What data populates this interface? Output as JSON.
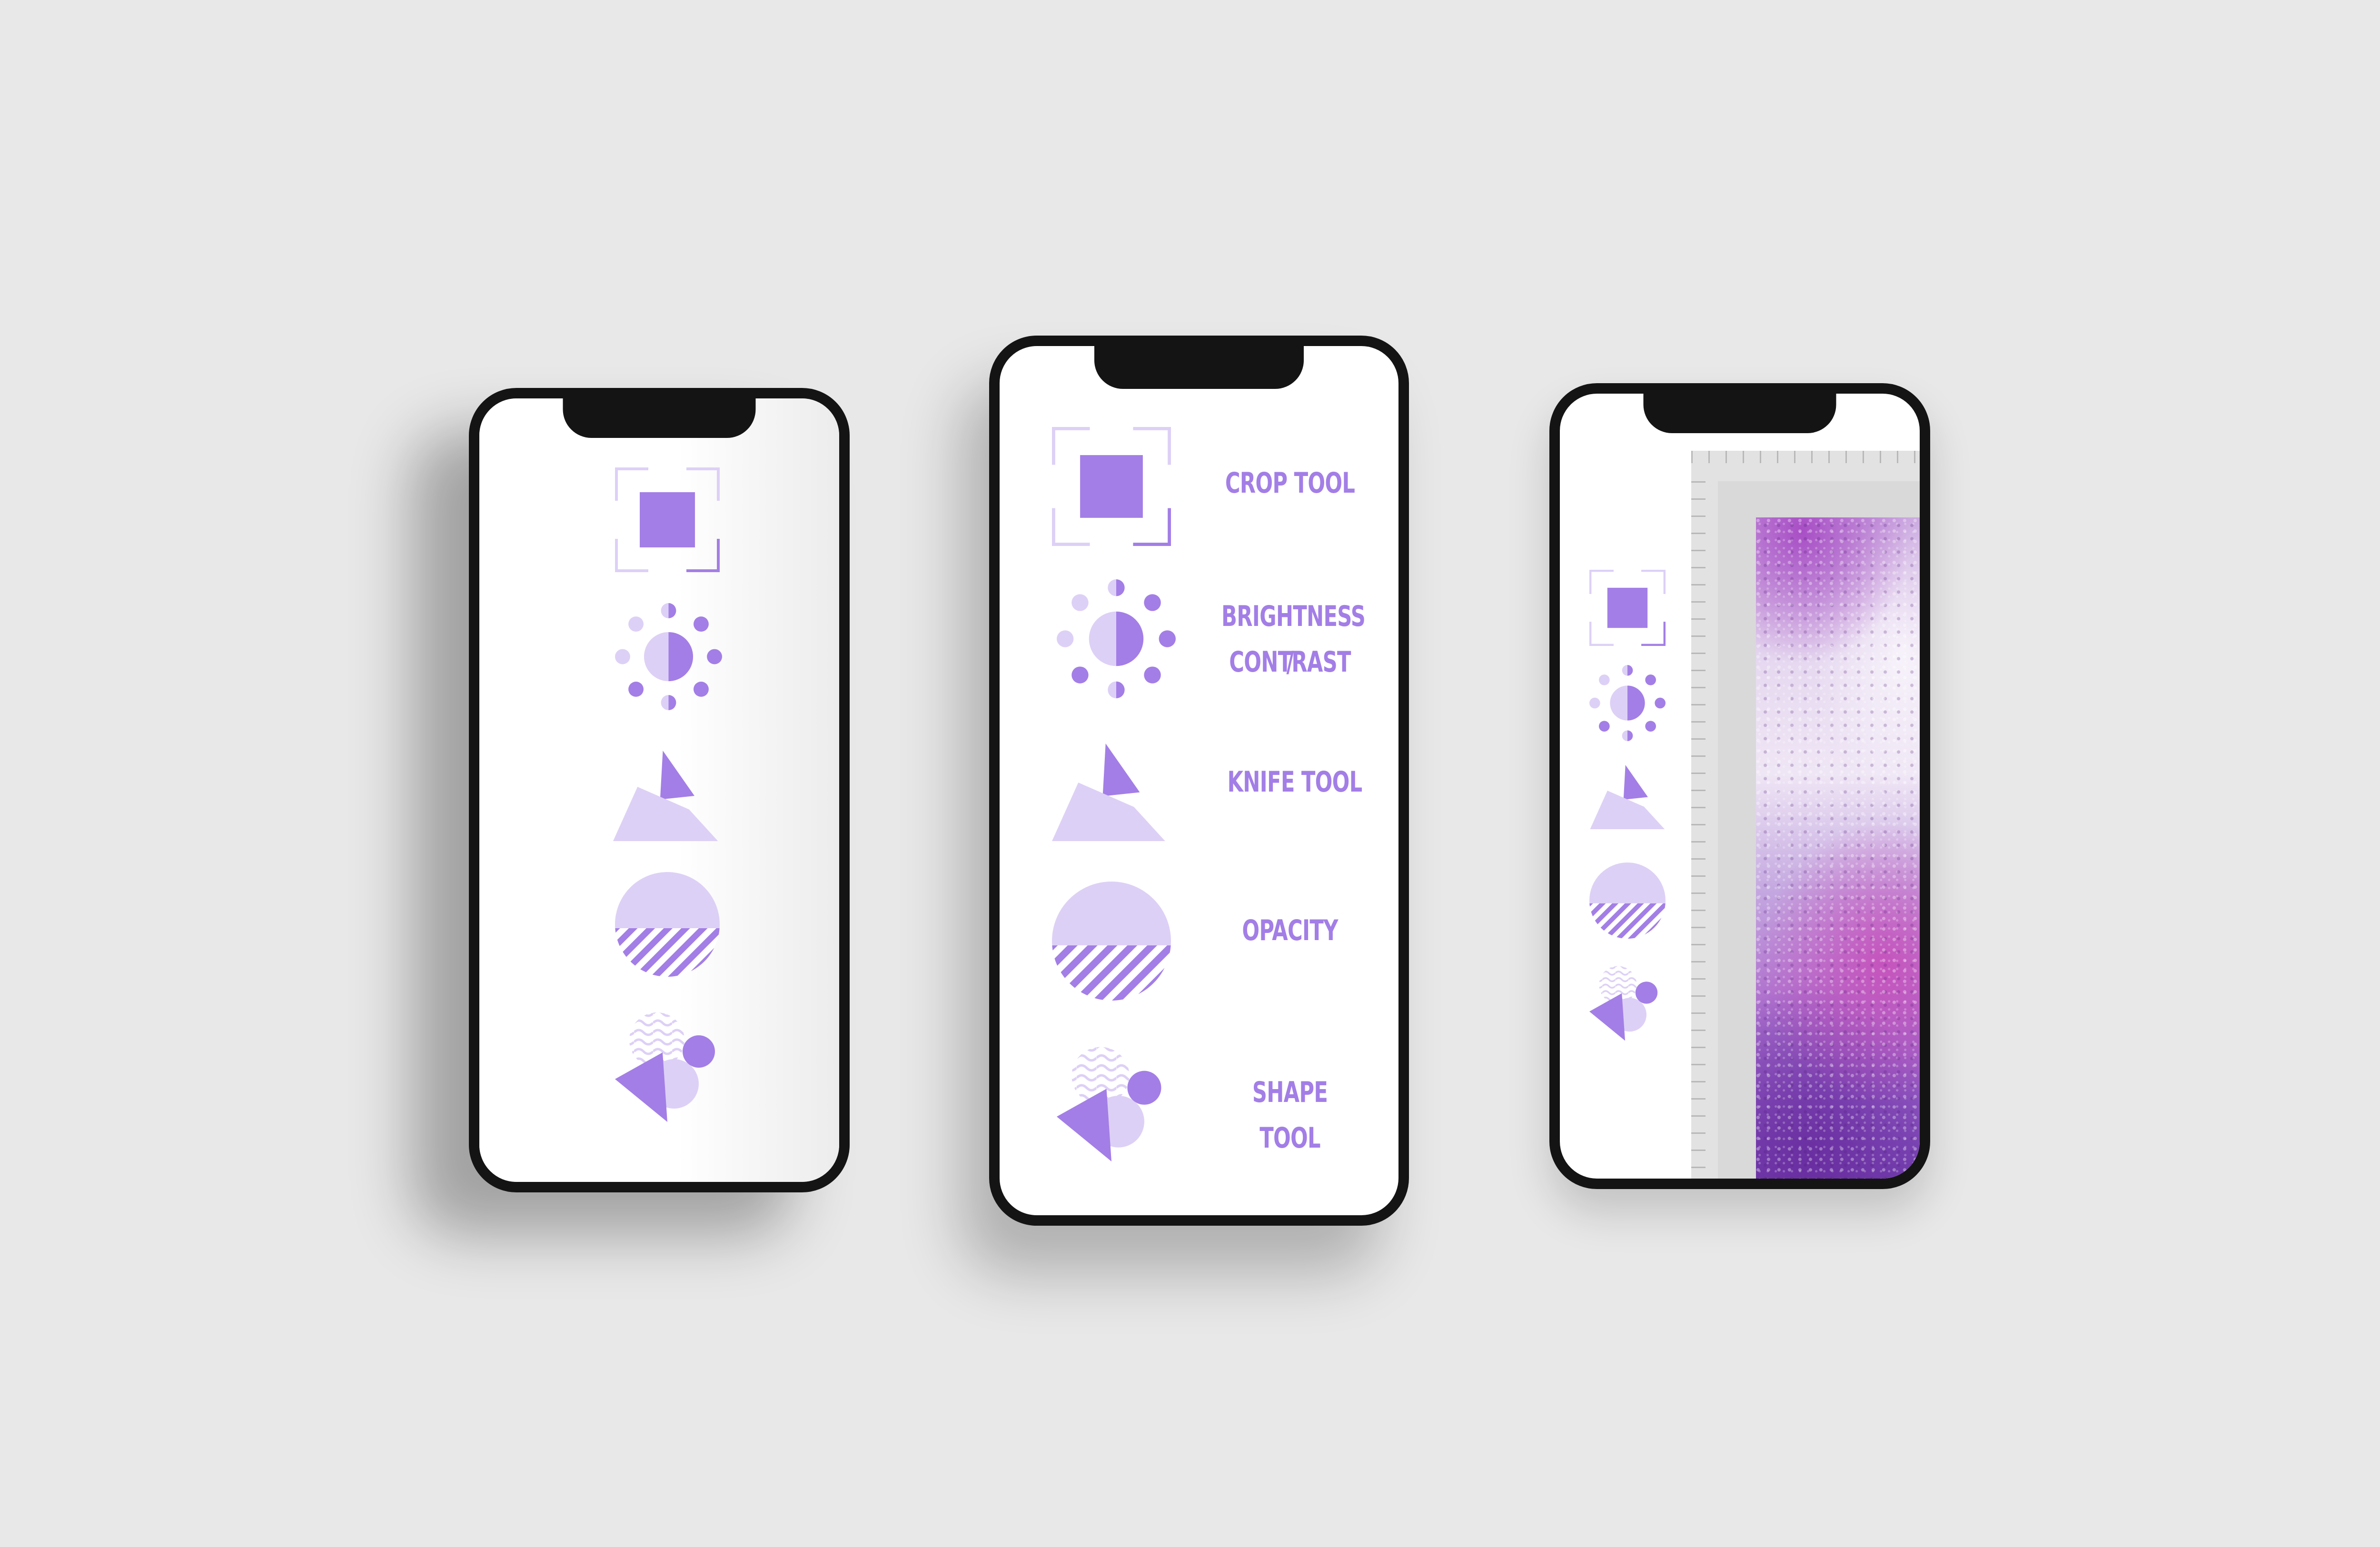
{
  "colors": {
    "background": "#e8e8e8",
    "phone_frame": "#141414",
    "accent": "#a37ee6",
    "accent_light": "#ddd0f6",
    "label_text": "#a37ee6"
  },
  "left_phone": {
    "icons": [
      "crop-icon",
      "brightness-contrast-icon",
      "knife-icon",
      "opacity-icon",
      "shape-icon"
    ]
  },
  "middle_phone": {
    "tools": [
      {
        "icon": "crop-icon",
        "label": "CROP TOOL"
      },
      {
        "icon": "brightness-contrast-icon",
        "label_line1": "BRIGHTNESS /",
        "label_line2": "CONTRAST"
      },
      {
        "icon": "knife-icon",
        "label": "KNIFE TOOL"
      },
      {
        "icon": "opacity-icon",
        "label": "OPACITY"
      },
      {
        "icon": "shape-icon",
        "label": "SHAPE TOOL"
      }
    ]
  },
  "right_phone": {
    "icons": [
      "crop-icon",
      "brightness-contrast-icon",
      "knife-icon",
      "opacity-icon",
      "shape-icon"
    ],
    "canvas": "purple-crystal-texture-image"
  }
}
